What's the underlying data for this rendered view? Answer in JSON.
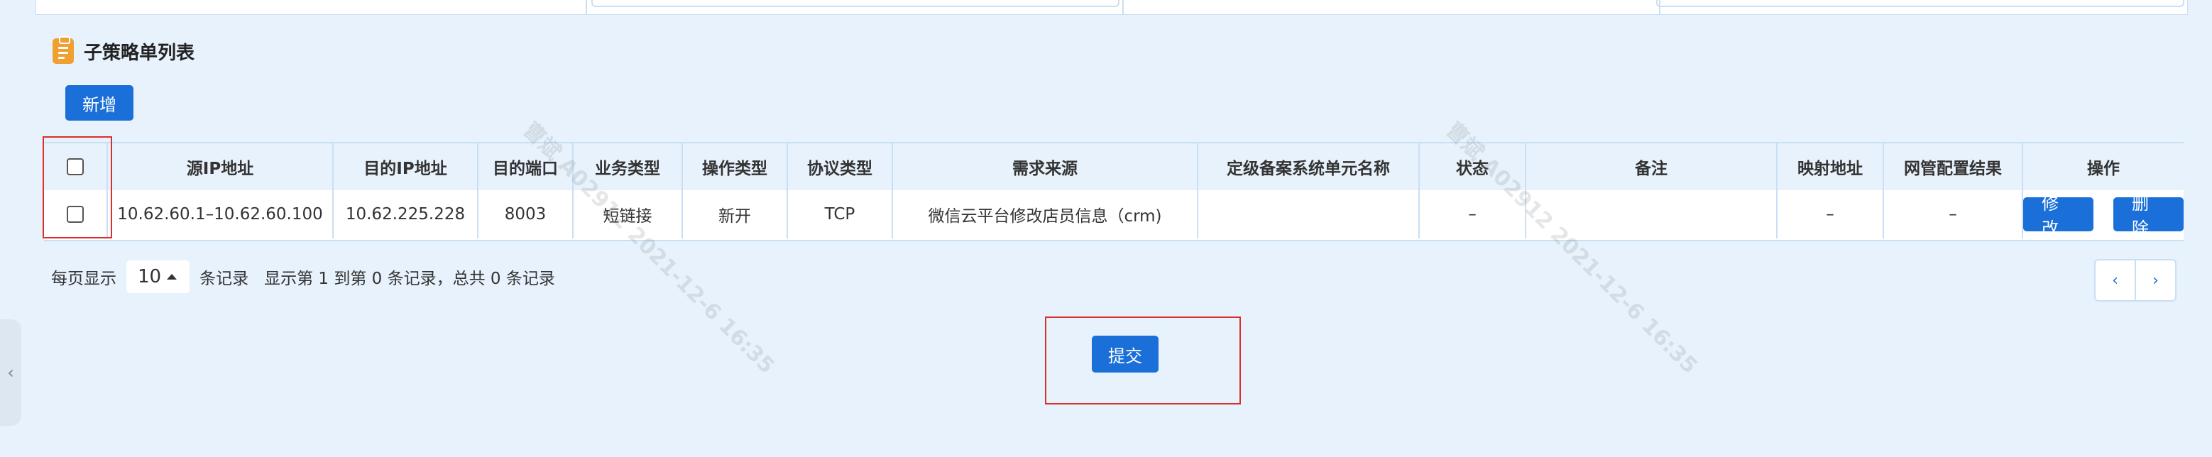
{
  "section_title": "子策略单列表",
  "add_button": "新增",
  "columns": [
    "源IP地址",
    "目的IP地址",
    "目的端口",
    "业务类型",
    "操作类型",
    "协议类型",
    "需求来源",
    "定级备案系统单元名称",
    "状态",
    "备注",
    "映射地址",
    "网管配置结果",
    "操作"
  ],
  "rows": [
    {
      "source_ip": "10.62.60.1–10.62.60.100",
      "dest_ip": "10.62.225.228",
      "dest_port": "8003",
      "business_type": "短链接",
      "operation_type": "新开",
      "protocol": "TCP",
      "demand_source": "微信云平台修改店员信息（crm)",
      "system_unit": "",
      "status": "–",
      "remark": "",
      "mapping_address": "–",
      "config_result": "–",
      "edit_label": "修改",
      "delete_label": "删除"
    }
  ],
  "pager": {
    "per_page_label": "每页显示",
    "page_size": "10",
    "records_label": "条记录",
    "summary": "显示第 1 到第 0 条记录，总共 0 条记录",
    "prev": "‹",
    "next": "›"
  },
  "submit_button": "提交",
  "left_handle": "‹",
  "watermarks": [
    "曹斌 A02912 2021-12-6 16:35",
    "曹斌 A02912 2021-12-6 16:35"
  ],
  "colors": {
    "primary": "#1a6fd8",
    "highlight": "#d9302c",
    "background": "#e8f2fc",
    "section_icon": "#f0a030"
  }
}
